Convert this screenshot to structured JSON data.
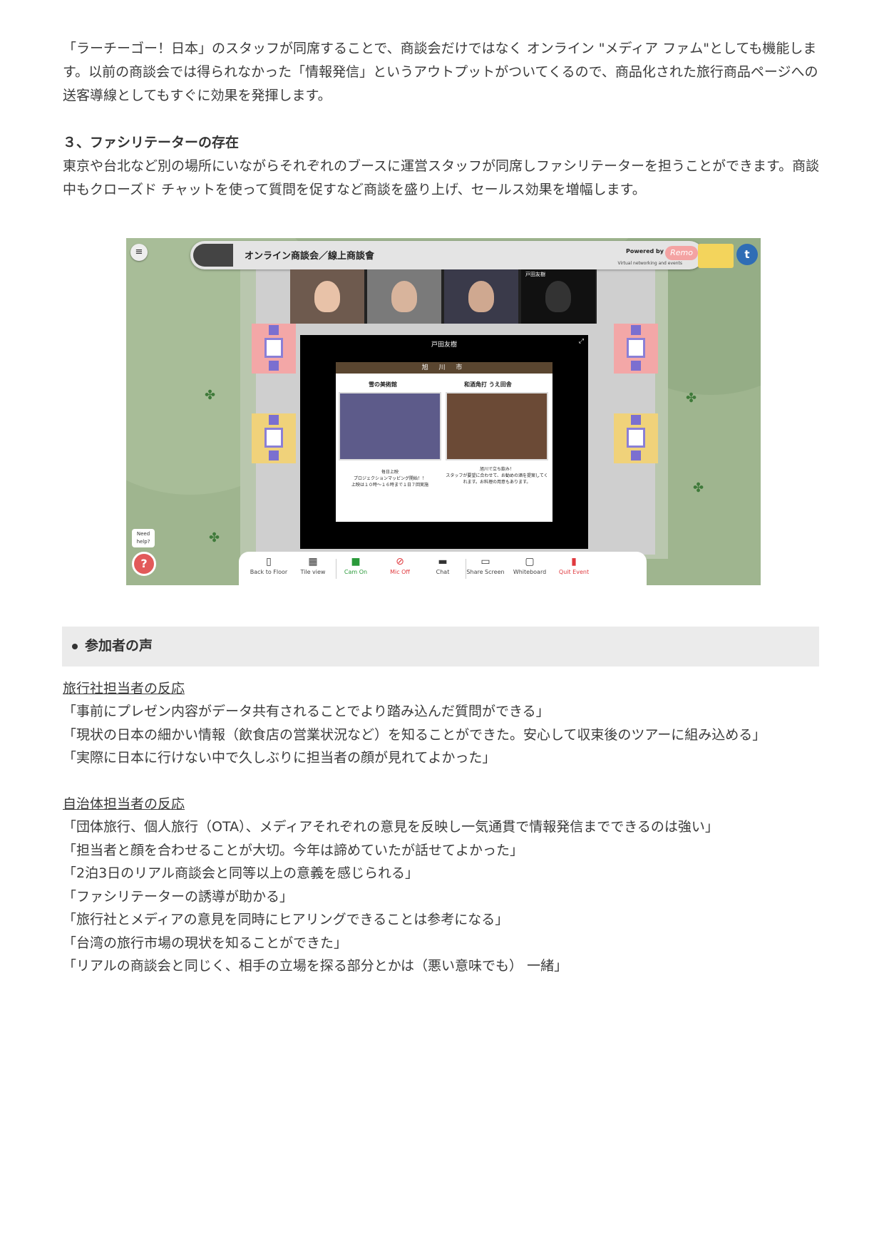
{
  "intro": "「ラーチーゴー！日本」のスタッフが同席することで、商談会だけではなく オンライン \"メディア ファム\"としても機能します。以前の商談会では得られなかった「情報発信」というアウトプットがついてくるので、商品化された旅行商品ページへの送客導線としてもすぐに効果を発揮します。",
  "section3": {
    "heading": "３、ファシリテーターの存在",
    "body": "東京や台北など別の場所にいながらそれぞれのブースに運営スタッフが同席しファシリテーターを担うことができます。商談中もクローズド チャットを使って質問を促すなど商談を盛り上げ、セールス効果を増幅します。"
  },
  "screenshot": {
    "event_title": "オンライン商談会／線上商談會",
    "powered_by": "Powered by",
    "brand": "Remo",
    "tagline": "Virtual networking and events",
    "avatar_letter": "t",
    "presenter": "戸田友樹",
    "camera_names": [
      "",
      "",
      "",
      "戸田友樹"
    ],
    "slide": {
      "banner": "旭 川 市",
      "left_heading": "雪の美術館",
      "right_heading": "和酒角打 うえ田舎",
      "left_caption_1": "毎日上映",
      "left_caption_2": "プロジェクションマッピング開始！！",
      "left_caption_3": "上映は１０時～１６時まで１日７回実施",
      "right_caption_1": "旭川で立ち飲み！",
      "right_caption_2": "スタッフが要望に合わせて、お勧めの酒を提案してくれます。お料理の用意もあります。"
    },
    "toolbar": [
      {
        "label": "Back to Floor",
        "icon": "map-icon"
      },
      {
        "label": "Tile view",
        "icon": "grid-icon"
      },
      {
        "label": "Cam On",
        "icon": "camera-icon"
      },
      {
        "label": "Mic Off",
        "icon": "mic-off-icon"
      },
      {
        "label": "Chat",
        "icon": "chat-icon"
      },
      {
        "label": "Share Screen",
        "icon": "screen-icon"
      },
      {
        "label": "Whiteboard",
        "icon": "whiteboard-icon"
      },
      {
        "label": "Quit Event",
        "icon": "exit-icon"
      }
    ],
    "need_help": "Need help?",
    "colors": {
      "background": "#9fb58f",
      "cam_on": "#2a9a3a",
      "mic_off": "#e0393e",
      "remo": "#f4a3a3"
    }
  },
  "voices": {
    "title": "参加者の声",
    "agency": {
      "heading": "旅行社担当者の反応",
      "quotes": [
        "「事前にプレゼン内容がデータ共有されることでより踏み込んだ質問ができる」",
        "「現状の日本の細かい情報（飲食店の営業状況など）を知ることができた。安心して収束後のツアーに組み込める」",
        "「実際に日本に行けない中で久しぶりに担当者の顔が見れてよかった」"
      ]
    },
    "municipal": {
      "heading": "自治体担当者の反応",
      "quotes": [
        "「団体旅行、個人旅行（OTA）、メディアそれぞれの意見を反映し一気通貫で情報発信までできるのは強い」",
        "「担当者と顔を合わせることが大切。今年は諦めていたが話せてよかった」",
        "「2泊3日のリアル商談会と同等以上の意義を感じられる」",
        "「ファシリテーターの誘導が助かる」",
        "「旅行社とメディアの意見を同時にヒアリングできることは参考になる」",
        "「台湾の旅行市場の現状を知ることができた」",
        "「リアルの商談会と同じく、相手の立場を探る部分とかは（悪い意味でも） 一緒」"
      ]
    }
  }
}
